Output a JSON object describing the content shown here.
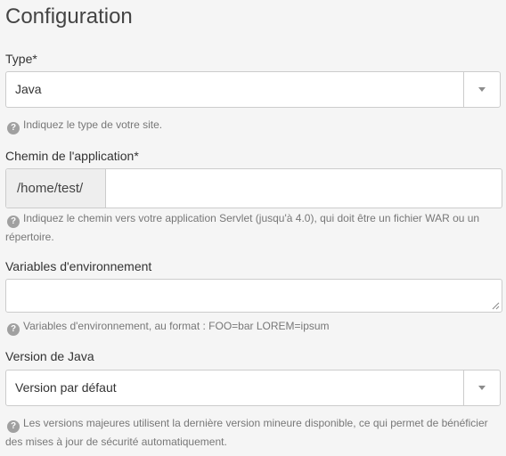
{
  "heading": "Configuration",
  "type_field": {
    "label": "Type*",
    "value": "Java",
    "help": "Indiquez le type de votre site."
  },
  "path_field": {
    "label": "Chemin de l'application*",
    "prefix": "/home/test/",
    "value": "",
    "help": "Indiquez le chemin vers votre application Servlet (jusqu'à 4.0), qui doit être un fichier WAR ou un répertoire."
  },
  "env_field": {
    "label": "Variables d'environnement",
    "value": "",
    "help": "Variables d'environnement, au format : FOO=bar LOREM=ipsum"
  },
  "java_version_field": {
    "label": "Version de Java",
    "value": "Version par défaut",
    "help": "Les versions majeures utilisent la dernière version mineure disponible, ce qui permet de bénéficier des mises à jour de sécurité automatiquement."
  },
  "icons": {
    "help": "question-circle-icon",
    "dropdown": "caret-down-icon",
    "resize": "resize-grip-icon"
  },
  "colors": {
    "background": "#f5f5f5",
    "border": "#cccccc",
    "addon_bg": "#eeeeee",
    "help_text": "#777777",
    "help_icon": "#a0a0a0"
  }
}
